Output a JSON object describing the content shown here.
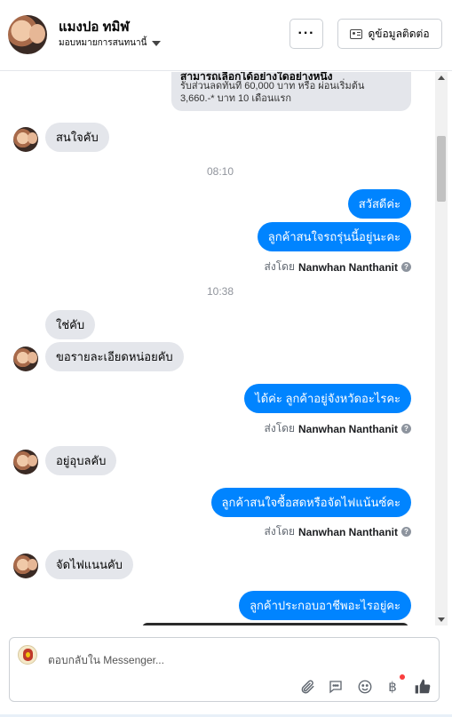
{
  "header": {
    "contact_name": "แมงปอ ทมิฬ",
    "assign_label": "มอบหมายการสนทนานี้",
    "more_label": "···",
    "contact_info_label": "ดูข้อมูลติดต่อ"
  },
  "thread": {
    "card": {
      "title": "สามารถเลือกได้อย่างใดอย่างหนึ่ง",
      "line1": "รับส่วนลดทันที 60,000 บาท หรือ ผ่อนเริ่มต้น",
      "line2": "3,660.-* บาท 10 เดือนแรก"
    },
    "messages": [
      {
        "dir": "in",
        "text": "สนใจคับ"
      },
      {
        "dir": "time",
        "text": "08:10"
      },
      {
        "dir": "out",
        "text": "สวัสดีค่ะ"
      },
      {
        "dir": "out",
        "text": "ลูกค้าสนใจรถรุ่นนี้อยู่นะคะ"
      },
      {
        "dir": "sent",
        "prefix": "ส่งโดย",
        "name": "Nanwhan Nanthanit"
      },
      {
        "dir": "time",
        "text": "10:38"
      },
      {
        "dir": "in",
        "text": "ใช่คับ"
      },
      {
        "dir": "in",
        "text": "ขอรายละเอียดหน่อยคับ"
      },
      {
        "dir": "out",
        "text": "ได้ค่ะ ลูกค้าอยู่จังหวัดอะไรคะ"
      },
      {
        "dir": "sent",
        "prefix": "ส่งโดย",
        "name": "Nanwhan Nanthanit"
      },
      {
        "dir": "in",
        "text": "อยู่อุบลคับ"
      },
      {
        "dir": "out",
        "text": "ลูกค้าสนใจซื้อสดหรือจัดไฟแน้นซ์คะ"
      },
      {
        "dir": "sent",
        "prefix": "ส่งโดย",
        "name": "Nanwhan Nanthanit"
      },
      {
        "dir": "in",
        "text": "จัดไฟแนนคับ"
      },
      {
        "dir": "out",
        "text": "ลูกค้าประกอบอาชีพอะไรอยู่คะ"
      }
    ]
  },
  "composer": {
    "placeholder": "ตอบกลับใน Messenger...",
    "tools": [
      "paperclip-icon",
      "saved-reply-icon",
      "emoji-icon",
      "payment-icon",
      "like-icon"
    ],
    "payment_symbol": "฿"
  },
  "colors": {
    "outgoing_bubble": "#0084ff",
    "incoming_bubble": "#e4e6eb",
    "notification_dot": "#fa3e3e"
  }
}
